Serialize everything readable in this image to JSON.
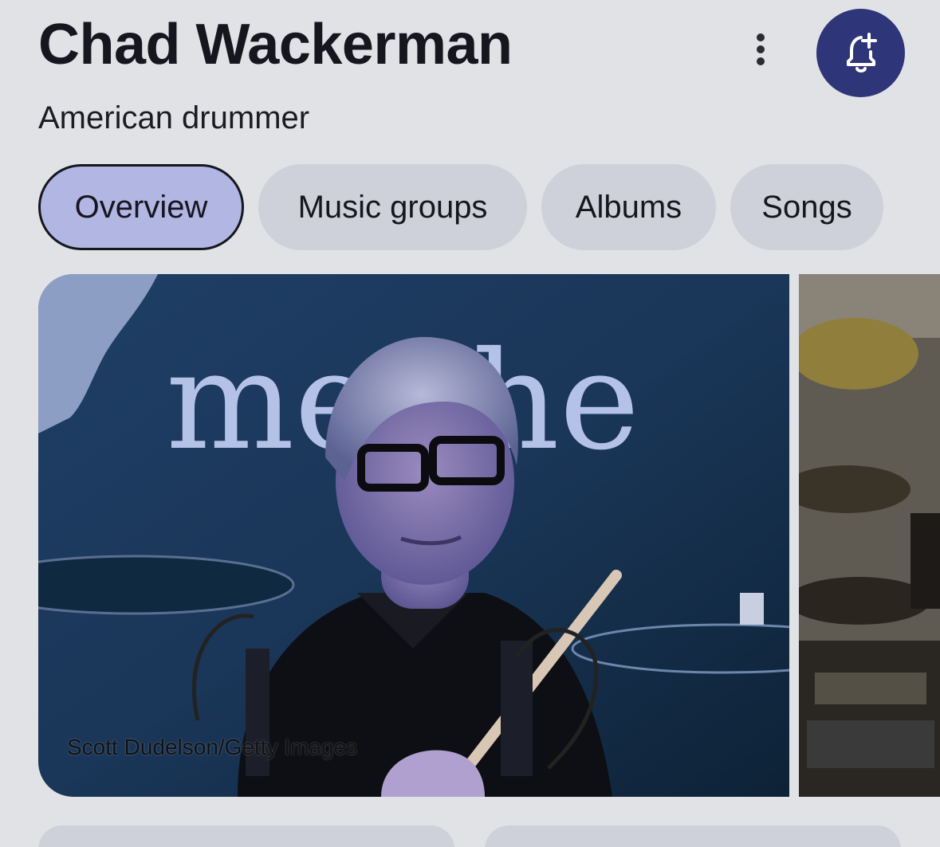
{
  "header": {
    "title": "Chad Wackerman",
    "subtitle": "American drummer",
    "more_icon": "more-vert-icon",
    "follow_icon": "bell-plus-icon"
  },
  "tabs": [
    {
      "label": "Overview",
      "active": true
    },
    {
      "label": "Music groups",
      "active": false
    },
    {
      "label": "Albums",
      "active": false
    },
    {
      "label": "Songs",
      "active": false
    }
  ],
  "gallery": {
    "main_photo": {
      "credit": "Scott Dudelson/Getty Images",
      "backdrop_text": "me   the"
    }
  },
  "colors": {
    "background": "#e1e2e5",
    "chip": "#cfd1da",
    "chip_active": "#b2b6e2",
    "accent": "#2e3578",
    "text": "#16161f"
  }
}
